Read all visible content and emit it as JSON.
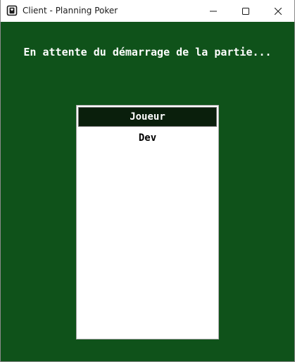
{
  "window": {
    "title": "Client - Planning Poker",
    "icon": "playing-card-icon",
    "controls": {
      "minimize_icon": "minimize-icon",
      "maximize_icon": "maximize-icon",
      "close_icon": "close-icon"
    }
  },
  "lobby": {
    "status_message": "En attente du démarrage de la partie...",
    "players_table": {
      "header": "Joueur",
      "players": [
        "Dev"
      ]
    }
  },
  "colors": {
    "background": "#0f521a",
    "header_background": "#0a1f0c",
    "text_light": "#ffffff",
    "text_dark": "#000000"
  }
}
